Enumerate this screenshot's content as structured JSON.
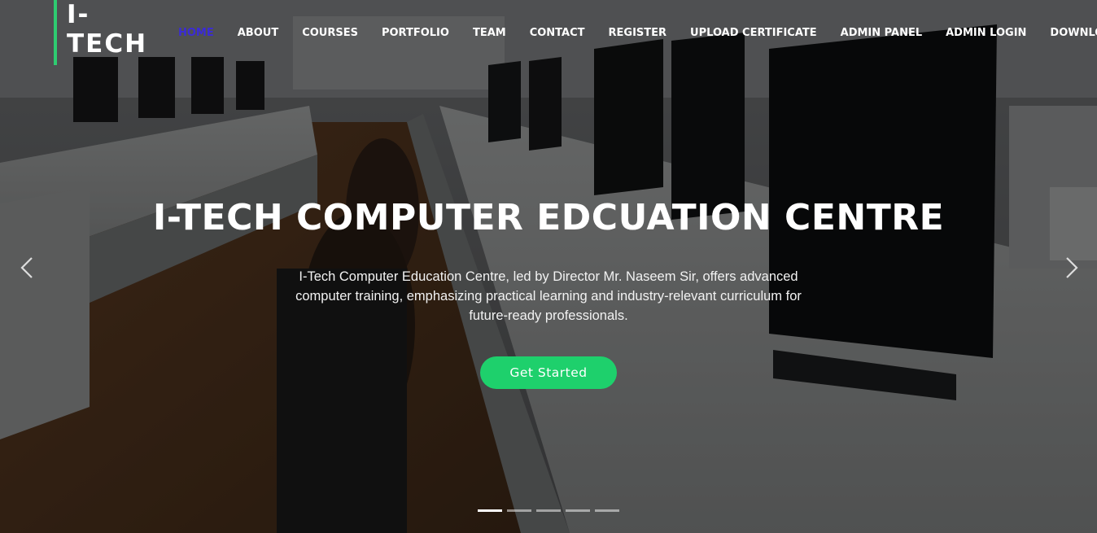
{
  "brand": {
    "logo_text": "I-TECH",
    "accent_color": "#2ecc71"
  },
  "nav": {
    "items": [
      {
        "label": "HOME",
        "active": true
      },
      {
        "label": "ABOUT"
      },
      {
        "label": "COURSES"
      },
      {
        "label": "PORTFOLIO"
      },
      {
        "label": "TEAM"
      },
      {
        "label": "CONTACT"
      },
      {
        "label": "REGISTER"
      },
      {
        "label": "UPLOAD CERTIFICATE"
      },
      {
        "label": "ADMIN PANEL"
      },
      {
        "label": "ADMIN LOGIN"
      },
      {
        "label": "DOWNLOA"
      }
    ],
    "active_color": "#3b2bd6"
  },
  "hero": {
    "title": "I-TECH COMPUTER EDCUATION CENTRE",
    "description": "I-Tech Computer Education Centre, led by Director Mr. Naseem Sir, offers advanced computer training, emphasizing practical learning and industry-relevant curriculum for future-ready professionals.",
    "cta_label": "Get Started",
    "cta_color": "#1ed06c",
    "background_description_icon": "computer-lab-photo"
  },
  "carousel": {
    "prev_icon": "chevron-left-icon",
    "next_icon": "chevron-right-icon",
    "slide_count": 5,
    "active_slide": 1
  }
}
